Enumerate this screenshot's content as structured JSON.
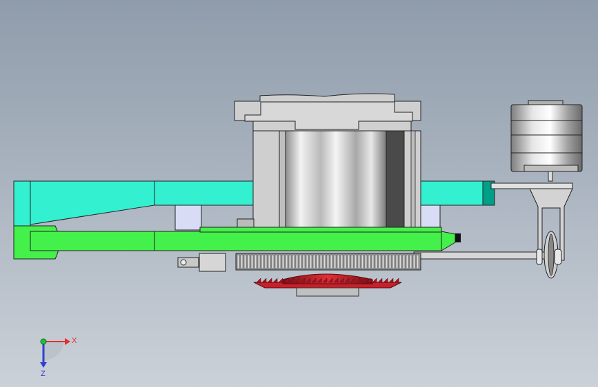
{
  "viewport": {
    "background_top": "#8f9cab",
    "background_bottom": "#cbd1d8"
  },
  "colors": {
    "upper_arm": "#33f0d0",
    "upper_arm_dark": "#00a088",
    "lower_arm": "#44f04a",
    "lower_arm_dark": "#1fb830",
    "housing": "#cfcfcf",
    "housing_dark": "#8a8a8a",
    "spacer": "#d8dcf4",
    "gear": "#9a9a9a",
    "cutter": "#c8202a",
    "cutter_dark": "#7a0f14",
    "axis_x": "#e03030",
    "axis_y": "#20c040",
    "axis_z": "#3040d0"
  },
  "triad": {
    "x_label": "X",
    "z_label": "Z"
  }
}
